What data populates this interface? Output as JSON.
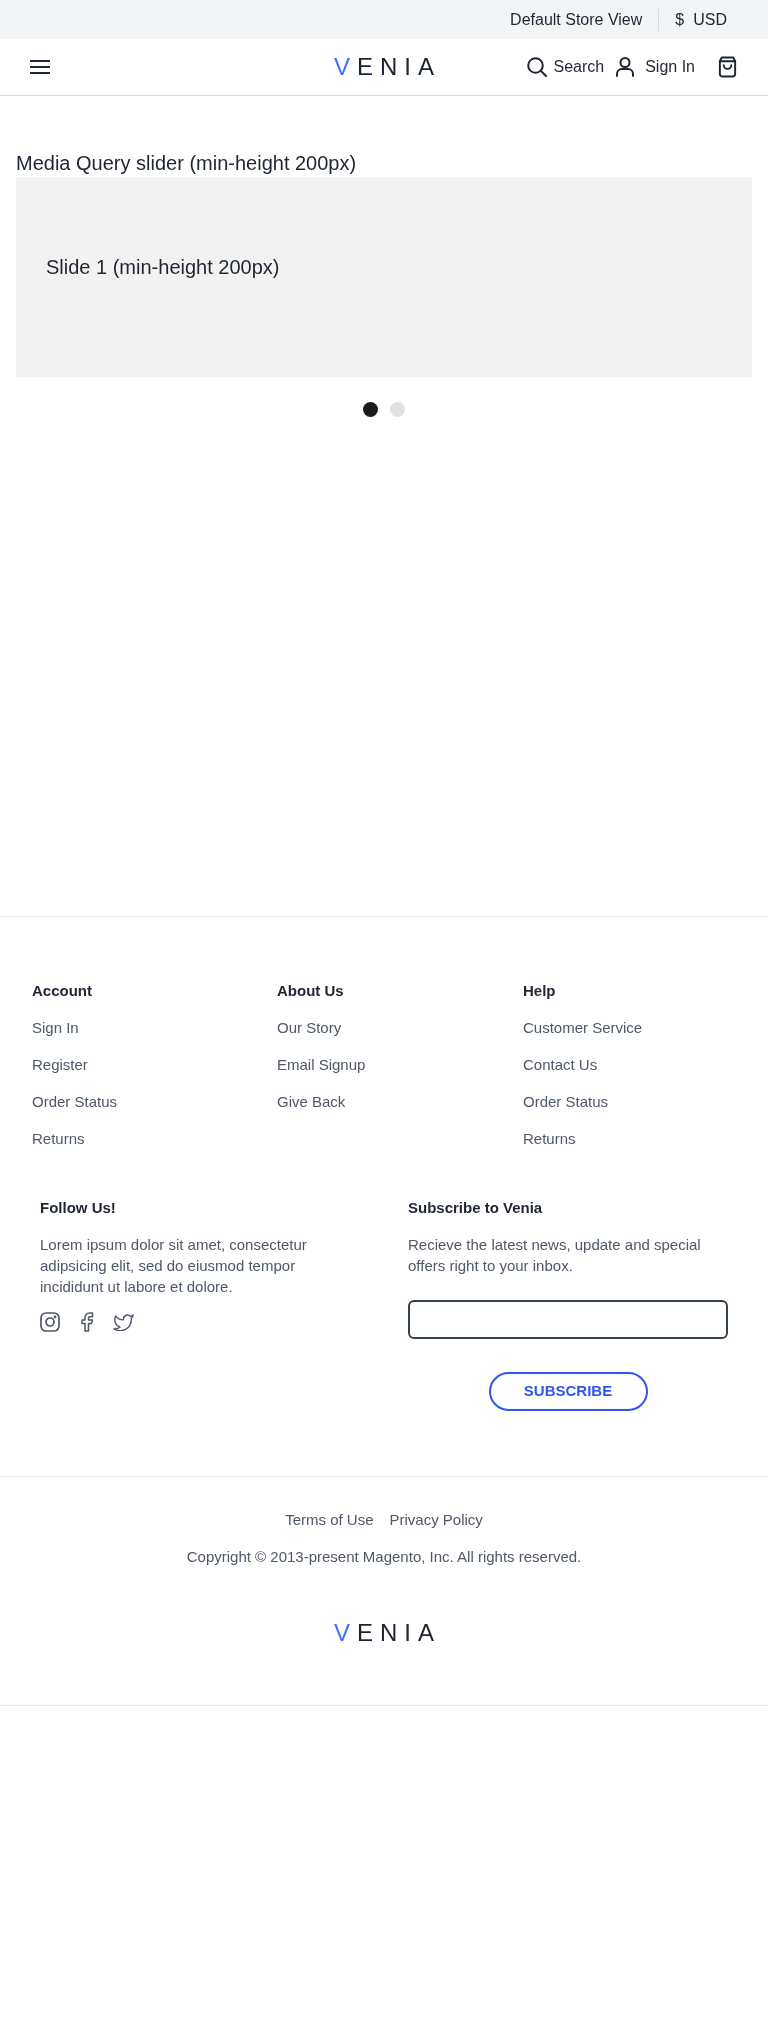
{
  "top_bar": {
    "store_view": "Default Store View",
    "currency_symbol": "$",
    "currency": "USD"
  },
  "header": {
    "logo": "VENIA",
    "search": "Search",
    "sign_in": "Sign In"
  },
  "slider": {
    "title": "Media Query slider (min-height 200px)",
    "slides": [
      {
        "text": "Slide 1 (min-height 200px)"
      }
    ],
    "dots": [
      {
        "selected": true
      },
      {
        "selected": false
      }
    ]
  },
  "footer": {
    "columns": [
      {
        "heading": "Account",
        "links": [
          "Sign In",
          "Register",
          "Order Status",
          "Returns"
        ]
      },
      {
        "heading": "About Us",
        "links": [
          "Our Story",
          "Email Signup",
          "Give Back"
        ]
      },
      {
        "heading": "Help",
        "links": [
          "Customer Service",
          "Contact Us",
          "Order Status",
          "Returns"
        ]
      }
    ],
    "follow": {
      "heading": "Follow Us!",
      "text": "Lorem ipsum dolor sit amet, consectetur adipsicing elit, sed do eiusmod tempor incididunt ut labore et dolore."
    },
    "subscribe": {
      "heading": "Subscribe to Venia",
      "text": "Recieve the latest news, update and special offers right to your inbox.",
      "button": "SUBSCRIBE"
    },
    "legal_links": [
      "Terms of Use",
      "Privacy Policy"
    ],
    "copyright": "Copyright © 2013-present Magento, Inc. All rights reserved.",
    "logo": "VENIA"
  }
}
